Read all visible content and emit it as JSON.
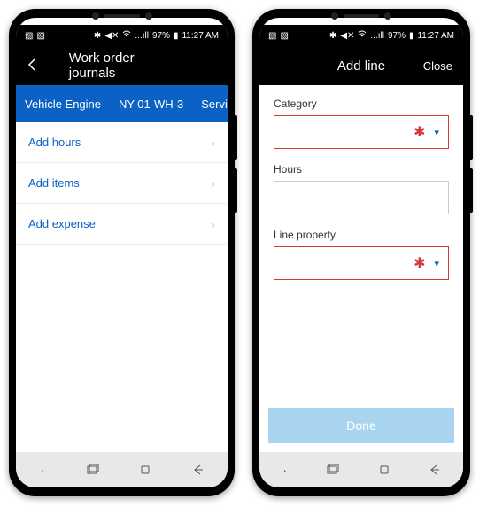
{
  "status": {
    "icons_left": "▧ ▧",
    "icons_right": "✱ ◀✕ �широ ...ıll",
    "battery": "97%",
    "time": "11:27 AM"
  },
  "phone1": {
    "header": {
      "title": "Work order journals"
    },
    "tabs": [
      "Vehicle Engine",
      "NY-01-WH-3",
      "Service"
    ],
    "items": [
      {
        "label": "Add hours"
      },
      {
        "label": "Add items"
      },
      {
        "label": "Add expense"
      }
    ]
  },
  "phone2": {
    "header": {
      "title": "Add line",
      "close": "Close"
    },
    "form": {
      "category_label": "Category",
      "hours_label": "Hours",
      "lineprop_label": "Line property"
    },
    "done": "Done"
  }
}
